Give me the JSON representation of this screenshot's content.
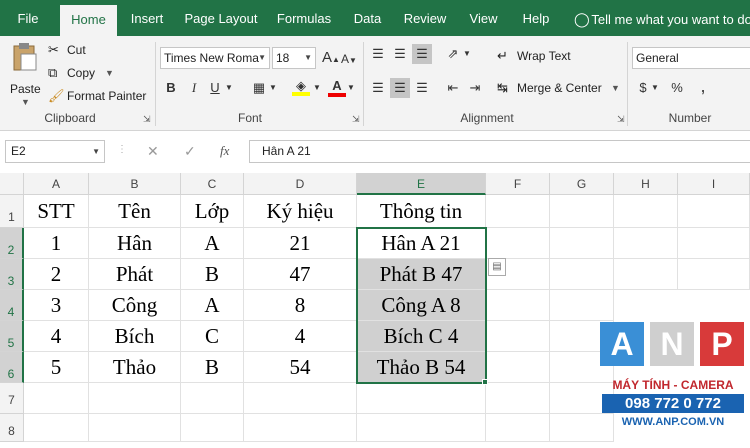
{
  "tabs": [
    "File",
    "Home",
    "Insert",
    "Page Layout",
    "Formulas",
    "Data",
    "Review",
    "View",
    "Help"
  ],
  "tell_me": "Tell me what you want to do",
  "clipboard": {
    "paste": "Paste",
    "cut": "Cut",
    "copy": "Copy",
    "format_painter": "Format Painter",
    "label": "Clipboard"
  },
  "font": {
    "name": "Times New Roma",
    "size": "18",
    "label": "Font",
    "bold": "B",
    "italic": "I",
    "underline": "U"
  },
  "alignment": {
    "wrap": "Wrap Text",
    "merge": "Merge & Center",
    "label": "Alignment"
  },
  "number": {
    "format": "General",
    "label": "Number",
    "currency": "$",
    "percent": "%",
    "comma": ","
  },
  "formula_bar": {
    "name_box": "E2",
    "fx": "fx",
    "content": "Hân A 21"
  },
  "columns": [
    "A",
    "B",
    "C",
    "D",
    "E",
    "F",
    "G",
    "H",
    "I"
  ],
  "rows": [
    "1",
    "2",
    "3",
    "4",
    "5",
    "6",
    "7",
    "8"
  ],
  "sheet": {
    "header": [
      "STT",
      "Tên",
      "Lớp",
      "Ký hiệu",
      "Thông tin"
    ],
    "data": [
      [
        "1",
        "Hân",
        "A",
        "21",
        "Hân A 21"
      ],
      [
        "2",
        "Phát",
        "B",
        "47",
        "Phát B 47"
      ],
      [
        "3",
        "Công",
        "A",
        "8",
        "Công A 8"
      ],
      [
        "4",
        "Bích",
        "C",
        "4",
        "Bích C 4"
      ],
      [
        "5",
        "Thảo",
        "B",
        "54",
        "Thảo B 54"
      ]
    ]
  },
  "watermark": {
    "letters": [
      "A",
      "N",
      "P"
    ],
    "line1": "MÁY TÍNH - CAMERA",
    "phone": "098 772 0 772",
    "site": "WWW.ANP.COM.VN"
  },
  "colors": {
    "excel_green": "#217346",
    "highlight": "#d0d0d0"
  }
}
